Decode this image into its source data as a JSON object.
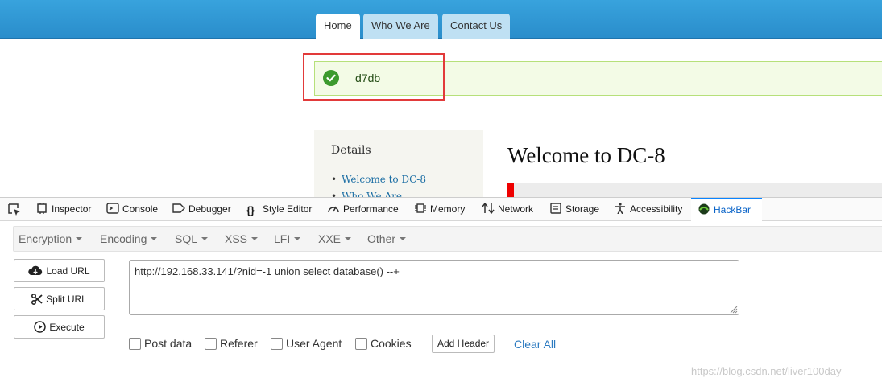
{
  "site": {
    "tabs": [
      {
        "label": "Home",
        "active": true
      },
      {
        "label": "Who We Are",
        "active": false
      },
      {
        "label": "Contact Us",
        "active": false
      }
    ],
    "status_message": "d7db",
    "status_icon": "check-circle-icon",
    "highlight_color": "#e23a3a",
    "sidebar": {
      "title": "Details",
      "links": [
        "Welcome to DC-8",
        "Who We Are"
      ]
    },
    "heading": "Welcome to DC-8"
  },
  "devtools": {
    "tabs": [
      {
        "label": "Inspector",
        "icon": "inspector-icon"
      },
      {
        "label": "Console",
        "icon": "console-icon"
      },
      {
        "label": "Debugger",
        "icon": "debugger-icon"
      },
      {
        "label": "Style Editor",
        "icon": "style-editor-icon"
      },
      {
        "label": "Performance",
        "icon": "performance-icon"
      },
      {
        "label": "Memory",
        "icon": "memory-icon"
      },
      {
        "label": "Network",
        "icon": "network-icon"
      },
      {
        "label": "Storage",
        "icon": "storage-icon"
      },
      {
        "label": "Accessibility",
        "icon": "accessibility-icon"
      },
      {
        "label": "HackBar",
        "icon": "hackbar-icon",
        "active": true
      }
    ]
  },
  "hackbar": {
    "menus": [
      "Encryption",
      "Encoding",
      "SQL",
      "XSS",
      "LFI",
      "XXE",
      "Other"
    ],
    "buttons": {
      "load_url": "Load URL",
      "split_url": "Split URL",
      "execute": "Execute"
    },
    "url_value": "http://192.168.33.141/?nid=-1 union select database() --+",
    "checkboxes": [
      "Post data",
      "Referer",
      "User Agent",
      "Cookies"
    ],
    "add_header": "Add Header",
    "clear_all": "Clear All",
    "accent_color": "#2b7ac0"
  },
  "watermark": "https://blog.csdn.net/liver100day"
}
